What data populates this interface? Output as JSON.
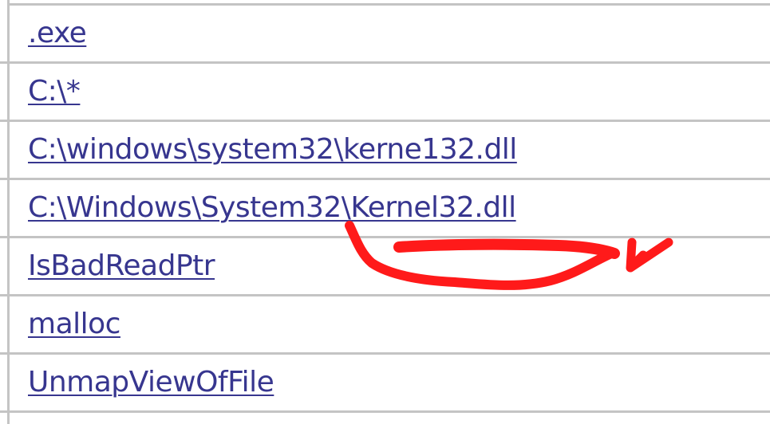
{
  "table": {
    "rows": [
      {
        "label": ".exe"
      },
      {
        "label": "C:\\*"
      },
      {
        "label": "C:\\windows\\system32\\kerne132.dll"
      },
      {
        "label": "C:\\Windows\\System32\\Kernel32.dll"
      },
      {
        "label": "IsBadReadPtr"
      },
      {
        "label": "malloc"
      },
      {
        "label": "UnmapViewOfFile"
      }
    ]
  },
  "colors": {
    "link": "#37368f",
    "grid": "#c4c4c4",
    "annotation": "#ff1a1a"
  }
}
